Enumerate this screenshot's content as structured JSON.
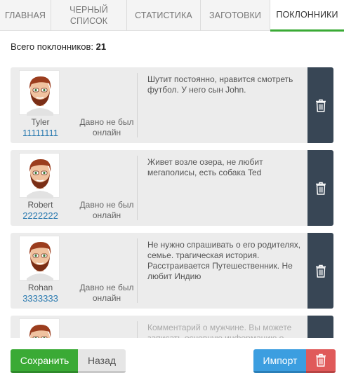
{
  "tabs": [
    {
      "label": "Главная",
      "active": false
    },
    {
      "label": "Черный список",
      "active": false
    },
    {
      "label": "Статистика",
      "active": false
    },
    {
      "label": "Заготовки",
      "active": false
    },
    {
      "label": "Поклонники",
      "active": true
    }
  ],
  "summary": {
    "label": "Всего поклонников:",
    "count": "21"
  },
  "fans": [
    {
      "name": "Tyler",
      "phone": "11111111",
      "status": "Давно не был онлайн",
      "comment": "Шутит постоянно, нравится смотреть футбол. У него сын John.",
      "placeholder": false
    },
    {
      "name": "Robert",
      "phone": "2222222",
      "status": "Давно не был онлайн",
      "comment": "Живет возле озера, не любит мегаполисы, есть собака Ted",
      "placeholder": false
    },
    {
      "name": "Rohan",
      "phone": "3333333",
      "status": "Давно не был онлайн",
      "comment": "Не нужно спрашивать о его родителях, семье. трагическая история. Расстраивается Путешественник. Не любит Индию",
      "placeholder": false
    },
    {
      "name": "",
      "phone": "",
      "status": "",
      "comment": "Комментарий о мужчине. Вы можете записать основную информацию о",
      "placeholder": true
    }
  ],
  "footer": {
    "save_label": "Сохранить",
    "back_label": "Назад",
    "import_label": "Импорт"
  },
  "icons": {
    "delete": "trash-icon",
    "avatar": "male-avatar-icon"
  },
  "colors": {
    "accent_green": "#3aaa35",
    "import_blue": "#3c9ee0",
    "danger_red": "#e05a5a",
    "delete_panel": "#384655",
    "link_blue": "#2a7ab0"
  }
}
